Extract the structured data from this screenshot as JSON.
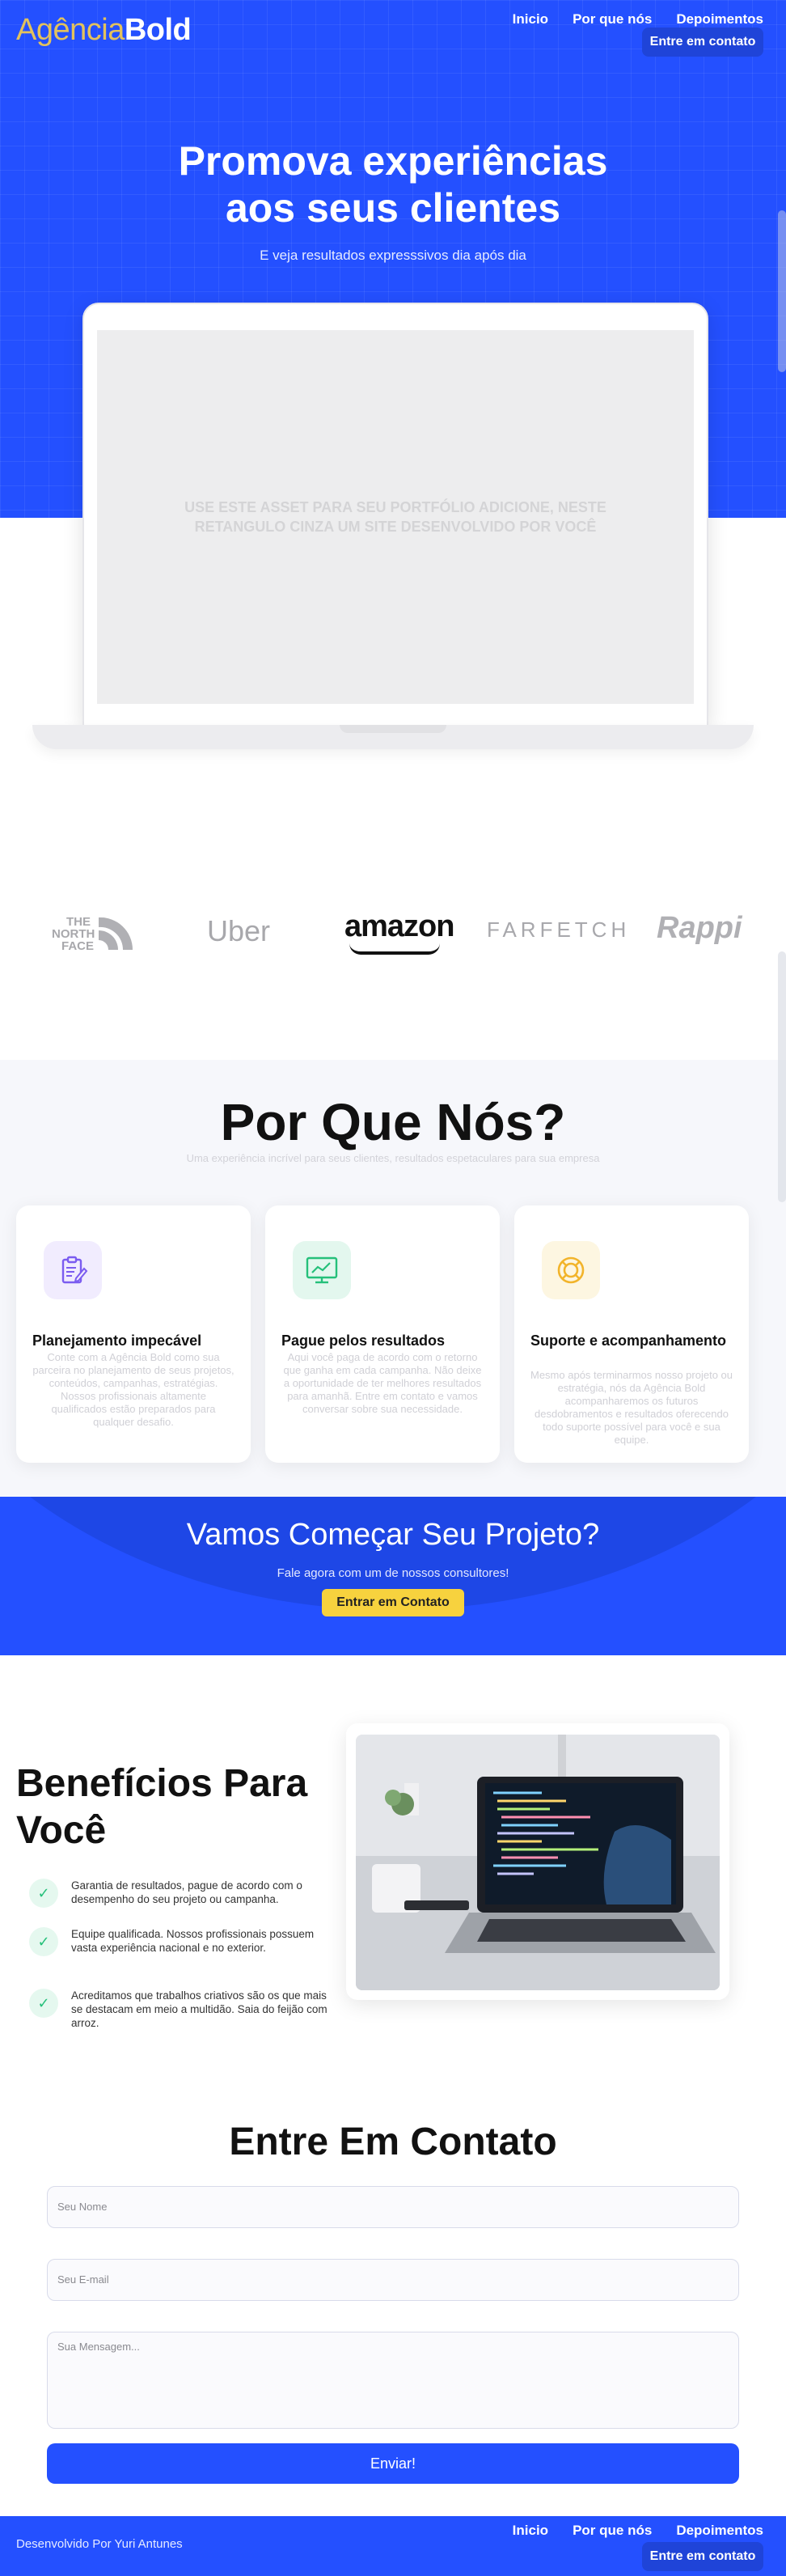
{
  "header": {
    "logo_light": "Agência",
    "logo_bold": "Bold",
    "nav": [
      "Inicio",
      "Por que nós",
      "Depoimentos"
    ],
    "cta": "Entre em contato"
  },
  "hero": {
    "title": "Promova experiências aos seus clientes",
    "subtitle": "E veja resultados expresssivos dia após dia",
    "placeholder": "USE ESTE ASSET PARA SEU PORTFÓLIO ADICIONE, NESTE RETANGULO CINZA UM SITE DESENVOLVIDO POR VOCÊ"
  },
  "brands": {
    "tnf": [
      "THE",
      "NORTH",
      "FACE"
    ],
    "uber": "Uber",
    "amazon": "amazon",
    "farfetch": "FARFETCH",
    "rappi": "Rappi"
  },
  "why": {
    "title": "Por Que Nós?",
    "subtitle": "Uma experiência incrível para seus clientes, resultados espetaculares para sua empresa",
    "cards": [
      {
        "title": "Planejamento impecável",
        "text": "Conte com a Agência Bold como sua parceira no planejamento de seus projetos, conteúdos, campanhas, estratégias. Nossos profissionais altamente qualificados estão preparados para qualquer desafio.",
        "icon": "clipboard-icon",
        "color": "#7b5cf0"
      },
      {
        "title": "Pague pelos resultados",
        "text": "Aqui você paga de acordo com o retorno que ganha em cada campanha. Não deixe a oportunidade de ter melhores resultados para amanhã. Entre em contato e vamos conversar sobre sua necessidade.",
        "icon": "monitor-chart-icon",
        "color": "#25c07a"
      },
      {
        "title": "Suporte e acompanhamento",
        "text": "Mesmo após terminarmos nosso projeto ou estratégia, nós da Agência Bold acompanharemos os futuros desdobramentos e resultados oferecendo todo suporte possível para você e sua equipe.",
        "icon": "lifebuoy-icon",
        "color": "#f2b42b"
      }
    ]
  },
  "band": {
    "title": "Vamos Começar Seu Projeto?",
    "subtitle": "Fale agora com um de nossos consultores!",
    "button": "Entrar em Contato"
  },
  "benefits": {
    "title": "Benefícios Para Você",
    "items": [
      "Garantia de resultados, pague de acordo com o desempenho do seu projeto ou campanha.",
      "Equipe qualificada. Nossos profissionais possuem vasta experiência nacional e no exterior.",
      "Acreditamos que trabalhos criativos são os que mais se destacam em meio a multidão. Saia do feijão com arroz."
    ]
  },
  "contact": {
    "title": "Entre Em Contato",
    "name_placeholder": "Seu Nome",
    "email_placeholder": "Seu  E-mail",
    "message_placeholder": "Sua Mensagem...",
    "send": "Enviar!"
  },
  "footer": {
    "credit": "Desenvolvido Por Yuri Antunes",
    "nav": [
      "Inicio",
      "Por que nós",
      "Depoimentos"
    ],
    "cta": "Entre em contato"
  },
  "colors": {
    "primary": "#2450ff",
    "accent": "#f7d23e",
    "logo_light": "#e3c25c"
  }
}
